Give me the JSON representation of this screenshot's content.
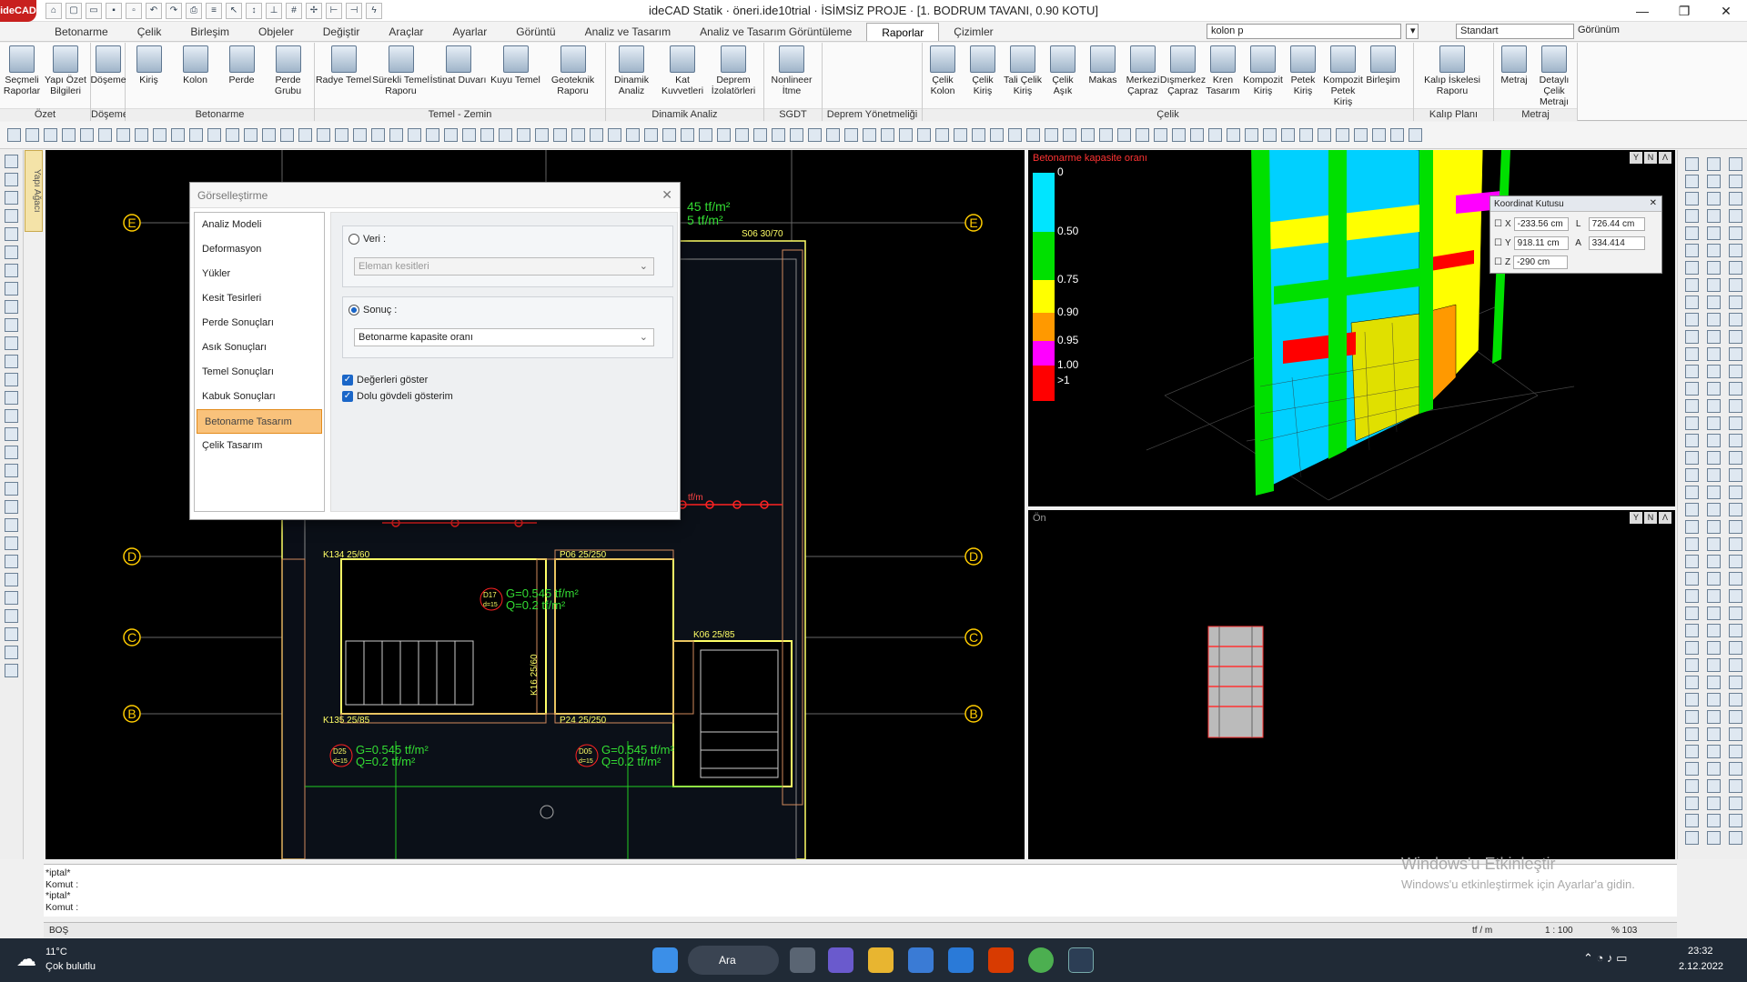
{
  "app": {
    "title": "ideCAD Statik · öneri.ide10trial · İSİMSİZ PROJE · [1. BODRUM TAVANI,  0.90 KOTU]",
    "logo": "ideCAD"
  },
  "tabs": [
    "Betonarme",
    "Çelik",
    "Birleşim",
    "Objeler",
    "Değiştir",
    "Araçlar",
    "Ayarlar",
    "Görüntü",
    "Analiz ve Tasarım",
    "Analiz ve Tasarım Görüntüleme",
    "Raporlar",
    "Çizimler"
  ],
  "active_tab": "Raporlar",
  "search": {
    "value": "kolon p"
  },
  "style_combo": "Standart",
  "view_combo": "Görünüm",
  "ribbon": [
    {
      "label": "Özet",
      "buttons": [
        "Seçmeli Raporlar",
        "Yapı Özet Bilgileri"
      ]
    },
    {
      "label": "Döşeme",
      "buttons": [
        "Döşeme"
      ]
    },
    {
      "label": "Betonarme",
      "buttons": [
        "Kiriş",
        "Kolon",
        "Perde",
        "Perde Grubu"
      ]
    },
    {
      "label": "Temel - Zemin",
      "buttons": [
        "Radye Temel",
        "Sürekli Temel Raporu",
        "İstinat Duvarı",
        "Kuyu Temel",
        "Geoteknik Raporu"
      ]
    },
    {
      "label": "Dinamik Analiz",
      "buttons": [
        "Dinamik Analiz",
        "Kat Kuvvetleri",
        "Deprem İzolatörleri"
      ]
    },
    {
      "label": "SGDT",
      "buttons": [
        "Nonlineer İtme"
      ]
    },
    {
      "label": "Deprem Yönetmeliği",
      "buttons": []
    },
    {
      "label": "Çelik",
      "buttons": [
        "Çelik Kolon",
        "Çelik Kiriş",
        "Tali Çelik Kiriş",
        "Çelik Aşık",
        "Makas",
        "Merkezi Çapraz",
        "Dışmerkez Çapraz",
        "Kren Tasarım",
        "Kompozit Kiriş",
        "Petek Kiriş",
        "Kompozit Petek Kiriş",
        "Birleşim"
      ]
    },
    {
      "label": "Kalıp Planı",
      "buttons": [
        "Kalıp İskelesi Raporu"
      ]
    },
    {
      "label": "Metraj",
      "buttons": [
        "Metraj",
        "Detaylı Çelik Metrajı"
      ]
    }
  ],
  "side_tab": "Yapı Ağacı",
  "plan": {
    "axes": [
      "E",
      "D",
      "C",
      "B"
    ],
    "labels": [
      "S06 30/70",
      "K134 25/60",
      "P06 25/250",
      "K06 25/85",
      "K135 25/85",
      "P24 25/250",
      "K17 25",
      "K16 25/60"
    ],
    "slab_loads": [
      {
        "id": "D25",
        "t": "d=15",
        "g": "G=0.545 tf/m²",
        "q": "Q=0.2 tf/m²"
      },
      {
        "id": "D05",
        "t": "d=15",
        "g": "G=0.545 tf/m²",
        "q": "Q=0.2 tf/m²"
      },
      {
        "id": "D17",
        "t": "d=15",
        "g": "G=0.545 tf/m²",
        "q": "Q=0.2 tf/m²"
      }
    ],
    "top_load_1": "45 tf/m²",
    "top_load_2": "5 tf/m²",
    "line_load": "tf/m"
  },
  "dialog": {
    "title": "Görselleştirme",
    "nav": [
      "Analiz Modeli",
      "Deformasyon",
      "Yükler",
      "Kesit Tesirleri",
      "Perde Sonuçları",
      "Asık Sonuçları",
      "Temel Sonuçları",
      "Kabuk Sonuçları",
      "Betonarme Tasarım",
      "Çelik Tasarım"
    ],
    "nav_selected": "Betonarme Tasarım",
    "veri_label": "Veri :",
    "veri_value": "Eleman kesitleri",
    "sonuc_label": "Sonuç :",
    "sonuc_value": "Betonarme kapasite oranı",
    "cb1": "Değerleri göster",
    "cb2": "Dolu gövdeli gösterim"
  },
  "view3d": {
    "title": "Betonarme kapasite oranı",
    "legend": [
      {
        "label": "0",
        "color": "#00e5ff"
      },
      {
        "label": "0.50",
        "color": "#00e000"
      },
      {
        "label": "0.75",
        "color": "#ffff00"
      },
      {
        "label": "0.90",
        "color": "#ff9900"
      },
      {
        "label": "0.95",
        "color": "#ff00ff"
      },
      {
        "label": "1.00",
        "color": "#ff0000"
      },
      {
        "label": ">1",
        "color": "#ff0000"
      }
    ]
  },
  "viewfront": {
    "title": "Ön"
  },
  "view_icons": [
    "Y",
    "N",
    "Λ"
  ],
  "koordinat": {
    "title": "Koordinat Kutusu",
    "x": "-233.56 cm",
    "l": "726.44 cm",
    "y": "918.11 cm",
    "a": "334.414",
    "z": "-290 cm",
    "lx": "X",
    "ly": "Y",
    "lz": "Z",
    "ll": "L",
    "la": "A"
  },
  "command": [
    "*iptal*",
    "Komut :",
    "*iptal*",
    "Komut :"
  ],
  "status": {
    "left": "BOŞ",
    "unit": "tf / m",
    "scale": "1 : 100",
    "zoom": "% 103"
  },
  "watermark": {
    "l1": "Windows'u Etkinleştir",
    "l2": "Windows'u etkinleştirmek için Ayarlar'a gidin."
  },
  "taskbar": {
    "temp": "11°C",
    "weather": "Çok bulutlu",
    "search": "Ara",
    "time": "23:32",
    "date": "2.12.2022"
  }
}
